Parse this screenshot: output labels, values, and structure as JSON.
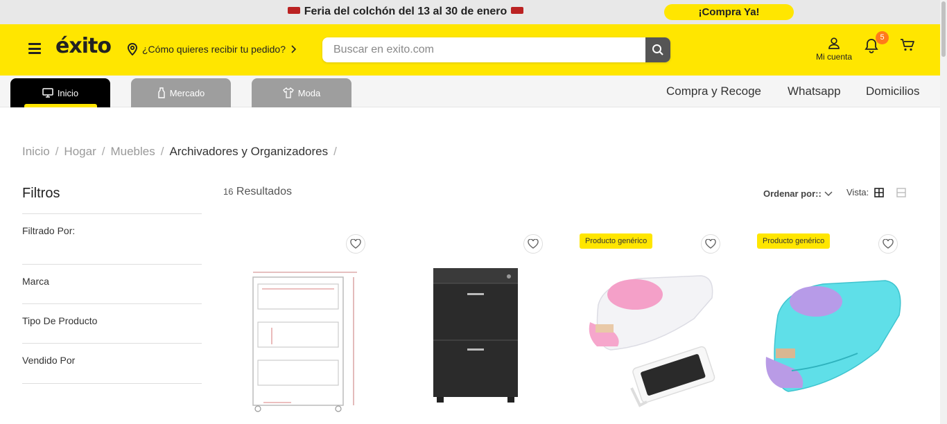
{
  "promo": {
    "text": "Feria del colchón del 13 al 30 de enero",
    "cta": "¡Compra Ya!"
  },
  "header": {
    "logo": "éxito",
    "delivery": "¿Cómo quieres recibir tu pedido?",
    "search_placeholder": "Buscar en exito.com",
    "account_label": "Mi cuenta",
    "notifications_count": "5"
  },
  "nav": {
    "tabs": [
      {
        "label": "Inicio"
      },
      {
        "label": "Mercado"
      },
      {
        "label": "Moda"
      }
    ],
    "links": [
      "Compra y Recoge",
      "Whatsapp",
      "Domicilios"
    ]
  },
  "breadcrumb": [
    "Inicio",
    "Hogar",
    "Muebles",
    "Archivadores y Organizadores"
  ],
  "filters": {
    "title": "Filtros",
    "filtered_by": "Filtrado Por:",
    "groups": [
      "Marca",
      "Tipo De Producto",
      "Vendido Por"
    ]
  },
  "results": {
    "count": "16",
    "label": "Resultados"
  },
  "sort": {
    "label": "Ordenar por::"
  },
  "view": {
    "label": "Vista:"
  },
  "products": [
    {
      "tag": ""
    },
    {
      "tag": ""
    },
    {
      "tag": "Producto genérico"
    },
    {
      "tag": "Producto genérico"
    }
  ],
  "colors": {
    "brand_yellow": "#ffe600",
    "nav_active": "#000000",
    "nav_inactive": "#9e9e9e",
    "badge": "#ff7a1a"
  }
}
